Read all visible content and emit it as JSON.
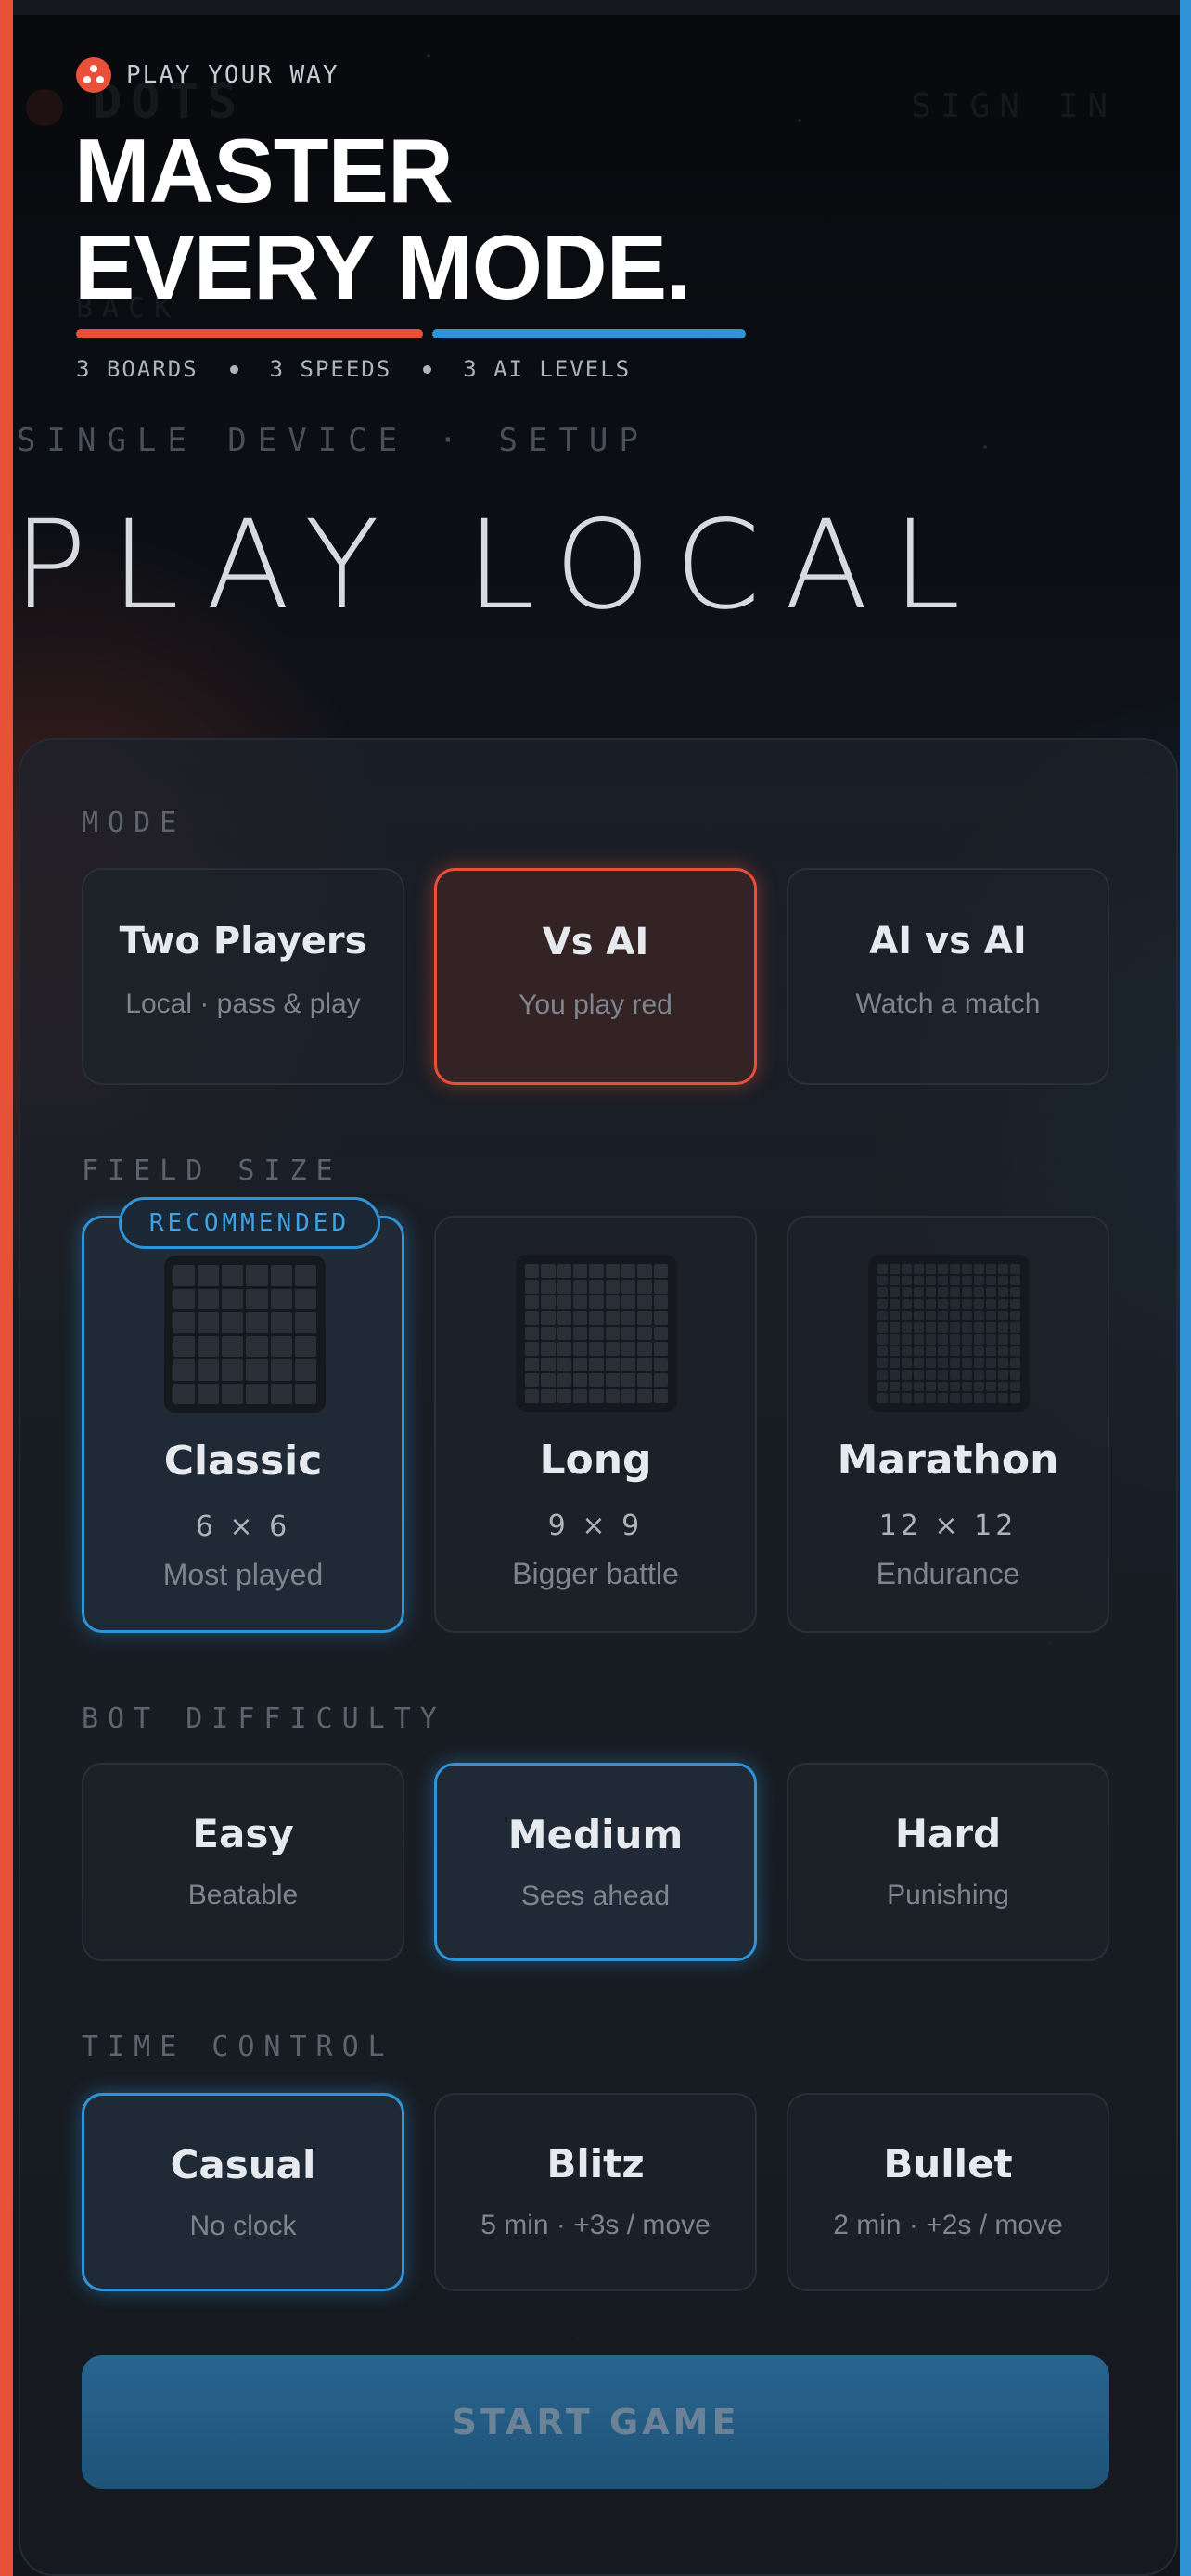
{
  "brand": {
    "tagline": "PLAY YOUR WAY",
    "headline": [
      "MASTER",
      "EVERY MODE."
    ],
    "stats": [
      "3 BOARDS",
      "3 SPEEDS",
      "3 AI LEVELS"
    ],
    "accent_red": "#e8503a",
    "accent_blue": "#2f93d6"
  },
  "ghost_header": {
    "logo": "DOTS",
    "sign_in": "SIGN IN",
    "back": "BACK"
  },
  "page": {
    "kicker": "SINGLE DEVICE · SETUP",
    "title": "PLAY LOCAL"
  },
  "mode": {
    "label": "MODE",
    "options": [
      {
        "title": "Two Players",
        "subtitle": "Local · pass & play",
        "selected": false
      },
      {
        "title": "Vs AI",
        "subtitle": "You play red",
        "selected": true
      },
      {
        "title": "AI vs AI",
        "subtitle": "Watch a match",
        "selected": false
      }
    ]
  },
  "field_size": {
    "label": "FIELD SIZE",
    "badge": "RECOMMENDED",
    "options": [
      {
        "title": "Classic",
        "dims": "6 × 6",
        "subtitle": "Most played",
        "selected": true
      },
      {
        "title": "Long",
        "dims": "9 × 9",
        "subtitle": "Bigger battle",
        "selected": false
      },
      {
        "title": "Marathon",
        "dims": "12 × 12",
        "subtitle": "Endurance",
        "selected": false
      }
    ]
  },
  "difficulty": {
    "label": "BOT DIFFICULTY",
    "options": [
      {
        "title": "Easy",
        "subtitle": "Beatable",
        "selected": false
      },
      {
        "title": "Medium",
        "subtitle": "Sees ahead",
        "selected": true
      },
      {
        "title": "Hard",
        "subtitle": "Punishing",
        "selected": false
      }
    ]
  },
  "time_control": {
    "label": "TIME CONTROL",
    "options": [
      {
        "title": "Casual",
        "subtitle": "No clock",
        "selected": true
      },
      {
        "title": "Blitz",
        "subtitle": "5 min · +3s / move",
        "selected": false
      },
      {
        "title": "Bullet",
        "subtitle": "2 min · +2s / move",
        "selected": false
      }
    ]
  },
  "start_button": "START GAME",
  "icons": {
    "brand": "dots-logo-icon"
  }
}
